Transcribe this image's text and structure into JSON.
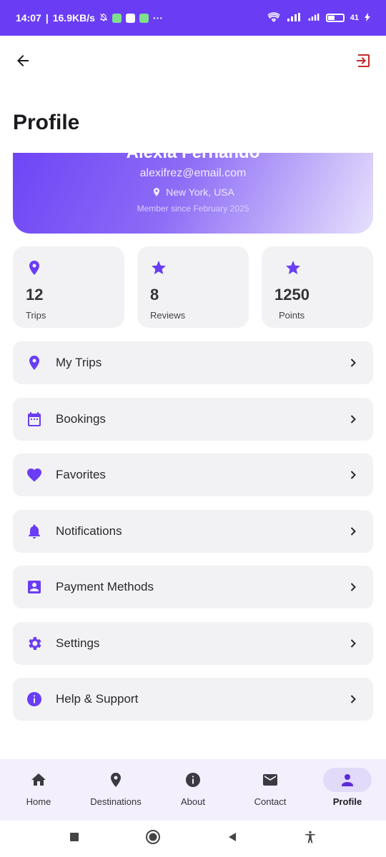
{
  "status_bar": {
    "time": "14:07",
    "speed": "16.9KB/s",
    "dots": "···",
    "battery_level": "41",
    "battery_fraction": 0.41
  },
  "app_bar": {
    "back_icon": "arrow-left-icon",
    "logout_icon": "logout-icon"
  },
  "page": {
    "title": "Profile"
  },
  "profile": {
    "name": "Alexia Fernando",
    "email": "alexifrez@email.com",
    "location": "New York, USA",
    "member_since": "Member since February 2025"
  },
  "stats": [
    {
      "icon": "location-pin-icon",
      "value": "12",
      "label": "Trips"
    },
    {
      "icon": "star-icon",
      "value": "8",
      "label": "Reviews"
    },
    {
      "icon": "star-icon",
      "value": "1250",
      "label": "Points"
    }
  ],
  "menu": [
    {
      "icon": "location-pin-icon",
      "label": "My Trips"
    },
    {
      "icon": "calendar-icon",
      "label": "Bookings"
    },
    {
      "icon": "heart-icon",
      "label": "Favorites"
    },
    {
      "icon": "bell-icon",
      "label": "Notifications"
    },
    {
      "icon": "payment-card-icon",
      "label": "Payment Methods"
    },
    {
      "icon": "gear-icon",
      "label": "Settings"
    },
    {
      "icon": "info-icon",
      "label": "Help & Support"
    }
  ],
  "bottom_nav": [
    {
      "icon": "home-icon",
      "label": "Home"
    },
    {
      "icon": "location-pin-icon",
      "label": "Destinations"
    },
    {
      "icon": "info-icon",
      "label": "About"
    },
    {
      "icon": "mail-icon",
      "label": "Contact"
    },
    {
      "icon": "person-icon",
      "label": "Profile",
      "active": true
    }
  ],
  "colors": {
    "accent": "#6a3df5",
    "status_bar": "#6a3df5",
    "logout": "#c62828",
    "card_bg": "#f2f2f4",
    "nav_bg": "#f3effd"
  }
}
